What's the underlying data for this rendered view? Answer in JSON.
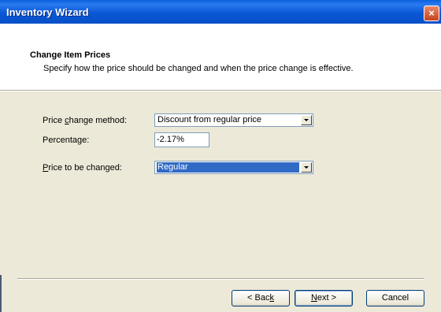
{
  "window": {
    "title": "Inventory Wizard",
    "close_label": "×"
  },
  "header": {
    "title": "Change Item Prices",
    "subtitle": "Specify how the price should be changed and when the price change is effective."
  },
  "form": {
    "method": {
      "label_before": "Price ",
      "label_access": "c",
      "label_after": "hange method:",
      "value": "Discount from regular price"
    },
    "percentage": {
      "label": "Percentage:",
      "value": "-2.17%"
    },
    "price_to_change": {
      "label_access": "P",
      "label_after": "rice to be changed:",
      "value": "Regular"
    }
  },
  "buttons": {
    "back": {
      "before": "< Bac",
      "access": "k",
      "after": ""
    },
    "next": {
      "before": "",
      "access": "N",
      "after": "ext >"
    },
    "cancel": "Cancel"
  }
}
